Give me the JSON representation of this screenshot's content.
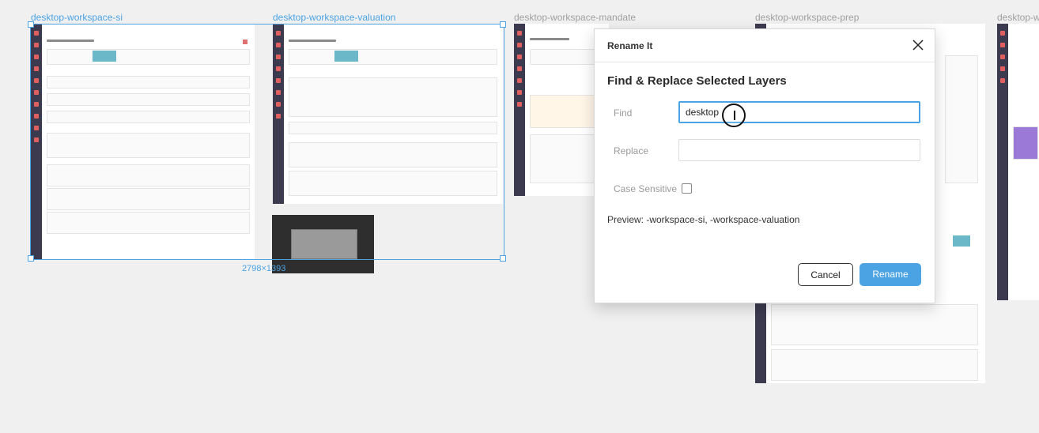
{
  "canvas": {
    "frames": [
      {
        "label": "desktop-workspace-si",
        "selected": true
      },
      {
        "label": "desktop-workspace-valuation",
        "selected": true
      },
      {
        "label": "desktop-workspace-mandate",
        "selected": false
      },
      {
        "label": "desktop-workspace-prep",
        "selected": false
      },
      {
        "label": "desktop-workspa",
        "selected": false
      }
    ],
    "selection_dimensions": "2798×1393"
  },
  "dialog": {
    "title": "Rename It",
    "heading": "Find & Replace Selected Layers",
    "find_label": "Find",
    "find_value": "desktop",
    "replace_label": "Replace",
    "replace_value": "",
    "case_sensitive_label": "Case Sensitive",
    "case_sensitive_checked": false,
    "preview_text": "Preview: -workspace-si, -workspace-valuation",
    "cancel_label": "Cancel",
    "rename_label": "Rename"
  },
  "colors": {
    "accent": "#4ba3e3",
    "sidebar": "#3b3a4f",
    "canvas_bg": "#f0f0f0"
  }
}
